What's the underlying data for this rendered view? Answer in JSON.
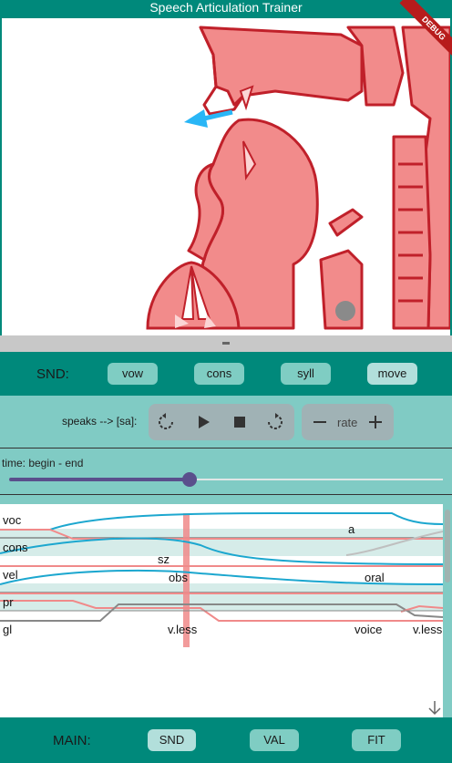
{
  "app": {
    "title": "Speech Articulation Trainer",
    "debug_label": "DEBUG"
  },
  "snd_bar": {
    "label": "SND:",
    "buttons": [
      {
        "label": "vow",
        "active": false
      },
      {
        "label": "cons",
        "active": false
      },
      {
        "label": "syll",
        "active": false
      },
      {
        "label": "move",
        "active": true
      }
    ]
  },
  "player": {
    "speaks": "speaks --> [sa]:",
    "rate_label": "rate",
    "icons": [
      "rewind-icon",
      "play-icon",
      "stop-icon",
      "forward-icon",
      "minus-icon",
      "plus-icon"
    ]
  },
  "time": {
    "label": "time: begin - end",
    "position": 0.41
  },
  "gestures": {
    "tiers": [
      "voc",
      "cons",
      "vel",
      "pr",
      "gl"
    ],
    "labels": [
      "a",
      "sz",
      "obs",
      "oral",
      "v.less",
      "voice",
      "v.less"
    ]
  },
  "main_bar": {
    "label": "MAIN:",
    "buttons": [
      {
        "label": "SND",
        "active": true
      },
      {
        "label": "VAL",
        "active": false
      },
      {
        "label": "FIT",
        "active": false
      }
    ]
  },
  "colors": {
    "teal_dark": "#00897b",
    "teal_light": "#80cbc4",
    "tract_fill": "#f28b8b",
    "tract_stroke": "#c0202a",
    "arrow_blue": "#29b6f6",
    "slider_purple": "#5a4f8c",
    "trace_blue": "#1ca7cf",
    "trace_pink": "#f08a8a",
    "trace_gray": "#888888"
  }
}
